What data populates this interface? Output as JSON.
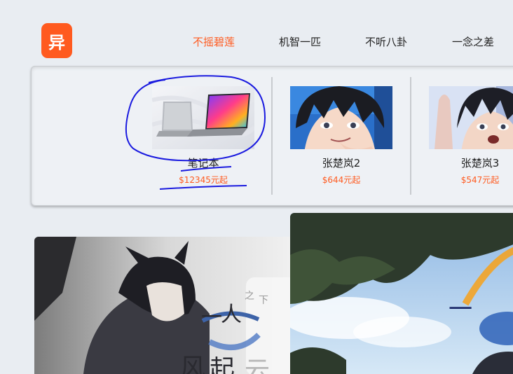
{
  "logo": {
    "glyph": "异",
    "color": "#ff5a1f"
  },
  "nav": [
    {
      "label": "不摇碧莲",
      "active": true
    },
    {
      "label": "机智一匹",
      "active": false
    },
    {
      "label": "不听八卦",
      "active": false
    },
    {
      "label": "一念之差",
      "active": false
    }
  ],
  "products": [
    {
      "name": "笔记本",
      "price": "$12345元起",
      "icon": "laptop-image"
    },
    {
      "name": "张楚岚2",
      "price": "$644元起",
      "icon": "anime-character-image"
    },
    {
      "name": "张楚岚3",
      "price": "$547元起",
      "icon": "anime-character-image"
    }
  ],
  "banners": [
    {
      "icon": "anime-poster-image",
      "title_glyphs": [
        "一",
        "人",
        "之",
        "下"
      ],
      "subtitle_glyphs": [
        "风",
        "起",
        "云"
      ]
    },
    {
      "icon": "anime-poster-image",
      "title_glyphs": [
        "一"
      ]
    }
  ],
  "colors": {
    "accent": "#ff5a1f",
    "annotation": "#1a1adf",
    "background": "#e9edf2"
  }
}
